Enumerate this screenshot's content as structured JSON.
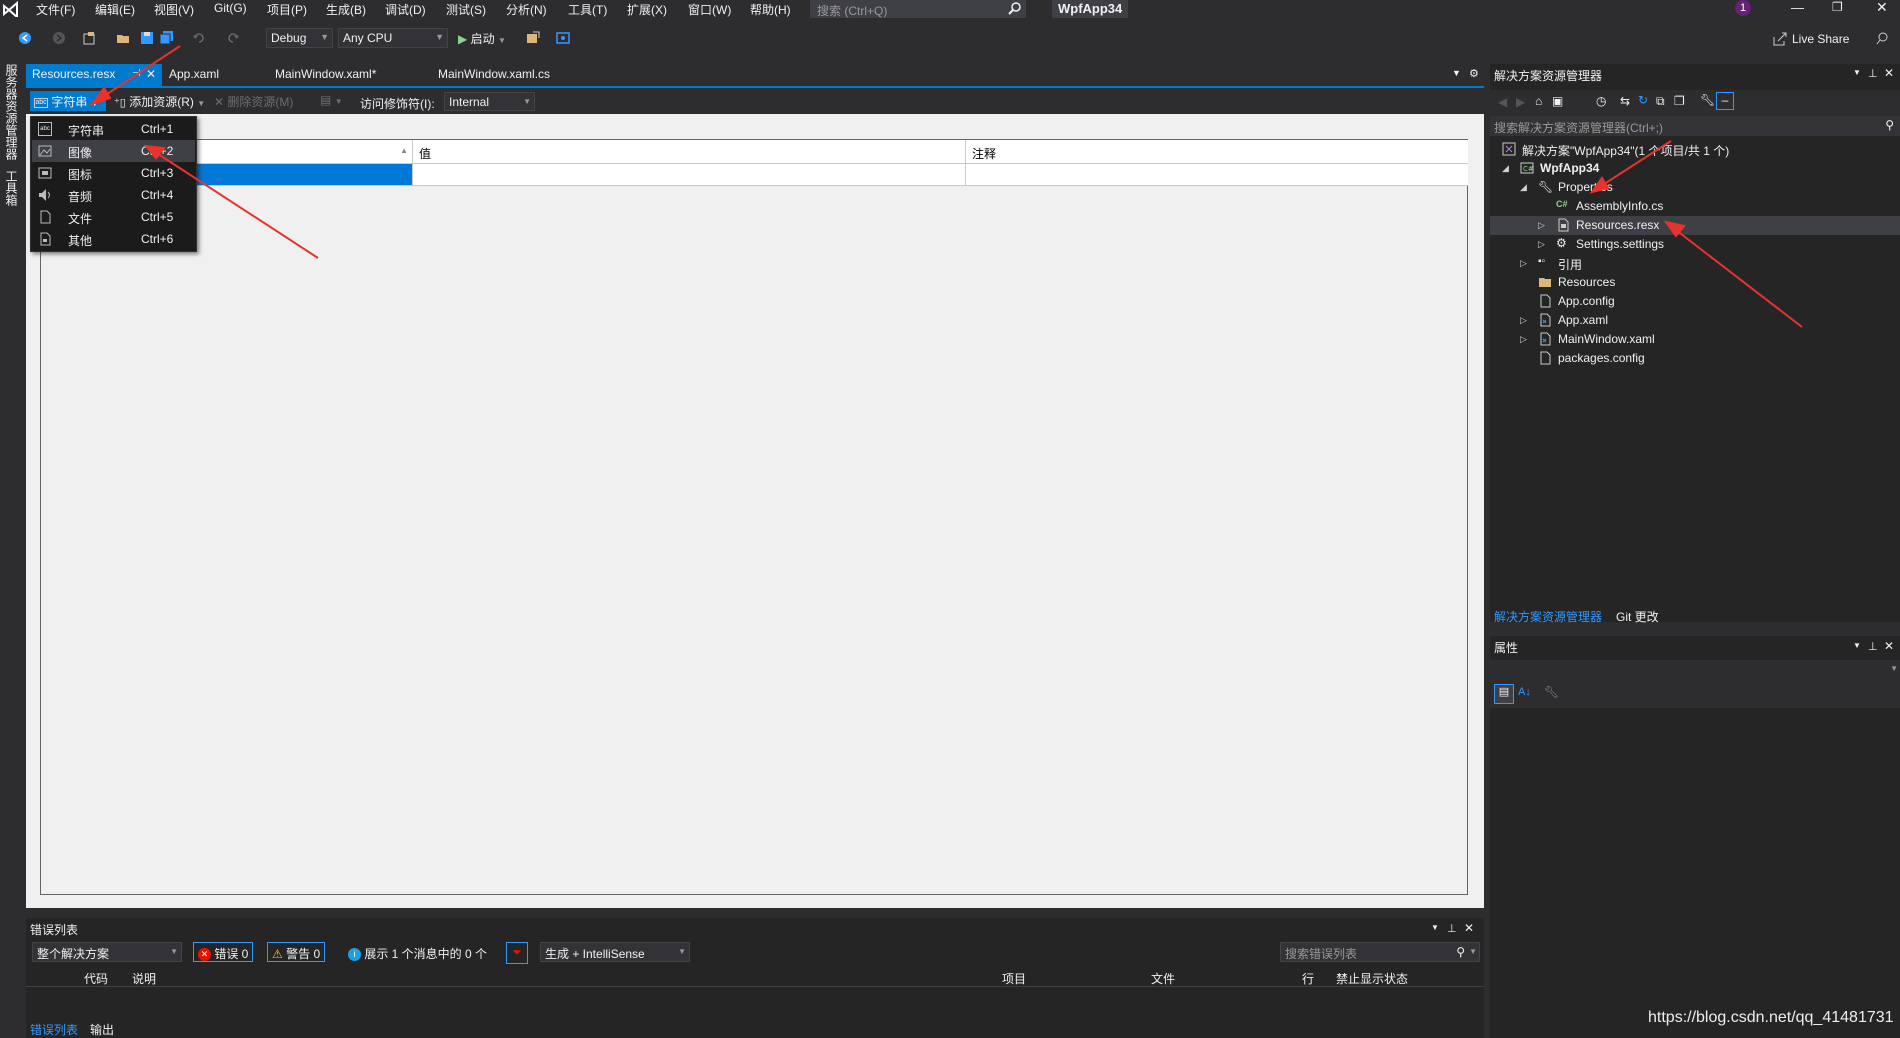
{
  "menu": {
    "items": [
      "文件(F)",
      "编辑(E)",
      "视图(V)",
      "Git(G)",
      "项目(P)",
      "生成(B)",
      "调试(D)",
      "测试(S)",
      "分析(N)",
      "工具(T)",
      "扩展(X)",
      "窗口(W)",
      "帮助(H)"
    ],
    "search_placeholder": "搜索 (Ctrl+Q)",
    "app_title": "WpfApp34",
    "notification_count": "1",
    "live_share": "Live Share"
  },
  "toolbar": {
    "config": "Debug",
    "platform": "Any CPU",
    "start_label": "启动"
  },
  "left_strip": {
    "server_explorer": "服务器资源管理器",
    "toolbox": "工具箱"
  },
  "doc_tabs": [
    {
      "label": "Resources.resx",
      "active": true
    },
    {
      "label": "App.xaml",
      "active": false
    },
    {
      "label": "MainWindow.xaml*",
      "active": false
    },
    {
      "label": "MainWindow.xaml.cs",
      "active": false
    }
  ],
  "res_toolbar": {
    "strings_button": "字符串",
    "add_resource": "添加资源(R)",
    "remove_resource": "删除资源(M)",
    "access_modifier_label": "访问修饰符(I):",
    "access_modifier_value": "Internal"
  },
  "grid": {
    "columns": [
      "",
      "值",
      "注释"
    ]
  },
  "dropdown": {
    "items": [
      {
        "label": "字符串",
        "shortcut": "Ctrl+1",
        "icon": "string-icon"
      },
      {
        "label": "图像",
        "shortcut": "Ctrl+2",
        "icon": "image-icon"
      },
      {
        "label": "图标",
        "shortcut": "Ctrl+3",
        "icon": "icon-icon"
      },
      {
        "label": "音频",
        "shortcut": "Ctrl+4",
        "icon": "audio-icon"
      },
      {
        "label": "文件",
        "shortcut": "Ctrl+5",
        "icon": "file-icon"
      },
      {
        "label": "其他",
        "shortcut": "Ctrl+6",
        "icon": "other-icon"
      }
    ]
  },
  "solution_explorer": {
    "title": "解决方案资源管理器",
    "search_placeholder": "搜索解决方案资源管理器(Ctrl+;)",
    "tree": [
      {
        "label": "解决方案\"WpfApp34\"(1 个项目/共 1 个)"
      },
      {
        "label": "WpfApp34"
      },
      {
        "label": "Properties"
      },
      {
        "label": "AssemblyInfo.cs"
      },
      {
        "label": "Resources.resx"
      },
      {
        "label": "Settings.settings"
      },
      {
        "label": "引用"
      },
      {
        "label": "Resources"
      },
      {
        "label": "App.config"
      },
      {
        "label": "App.xaml"
      },
      {
        "label": "MainWindow.xaml"
      },
      {
        "label": "packages.config"
      }
    ],
    "tab_active": "解决方案资源管理器",
    "tab_other": "Git 更改"
  },
  "properties": {
    "title": "属性"
  },
  "error_list": {
    "title": "错误列表",
    "scope": "整个解决方案",
    "errors": "错误 0",
    "warnings": "警告 0",
    "messages": "展示 1 个消息中的 0 个",
    "build_filter": "生成 + IntelliSense",
    "search_placeholder": "搜索错误列表",
    "columns": [
      "代码",
      "说明",
      "项目",
      "文件",
      "行",
      "禁止显示状态"
    ],
    "tab_active": "错误列表",
    "tab_other": "输出"
  },
  "watermark": "https://blog.csdn.net/qq_41481731",
  "colors": {
    "accent": "#007acc",
    "annotation_arrow": "#e8322d"
  }
}
